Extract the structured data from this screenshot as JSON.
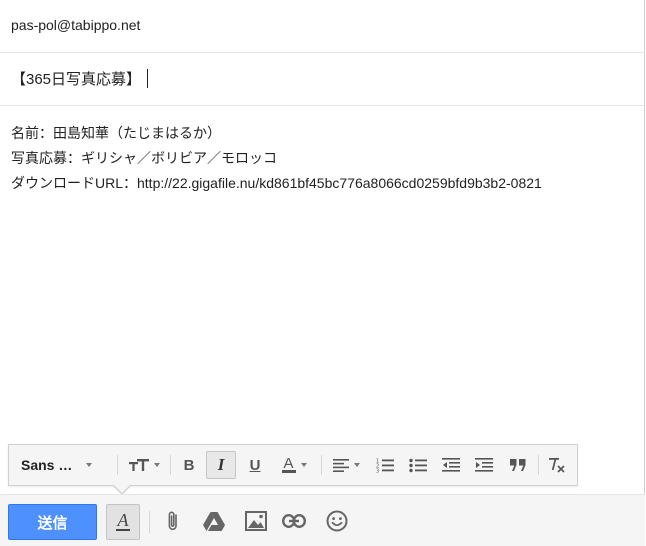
{
  "to": {
    "value": "pas-pol@tabippo.net"
  },
  "subject": {
    "value": "【365日写真応募】"
  },
  "body": {
    "lines": [
      "名前：田島知華（たじまはるか）",
      "写真応募：ギリシャ／ボリビア／モロッコ",
      "ダウンロードURL：http://22.gigafile.nu/kd861bf45bc776a8066cd0259bfd9b3b2-0821"
    ]
  },
  "format_toolbar": {
    "font_name": "Sans …",
    "items": [
      "font-family",
      "font-size",
      "bold",
      "italic",
      "underline",
      "text-color",
      "align",
      "numbered-list",
      "bulleted-list",
      "indent-less",
      "indent-more",
      "quote",
      "remove-formatting"
    ],
    "active": "italic"
  },
  "bottom_bar": {
    "send_label": "送信",
    "icons": [
      "text-format-icon",
      "attach-icon",
      "drive-icon",
      "photo-icon",
      "link-icon",
      "emoji-icon"
    ]
  },
  "colors": {
    "send_button": "#4d90fe",
    "toolbar_bg": "#f5f5f5",
    "icon_gray": "#555555"
  }
}
